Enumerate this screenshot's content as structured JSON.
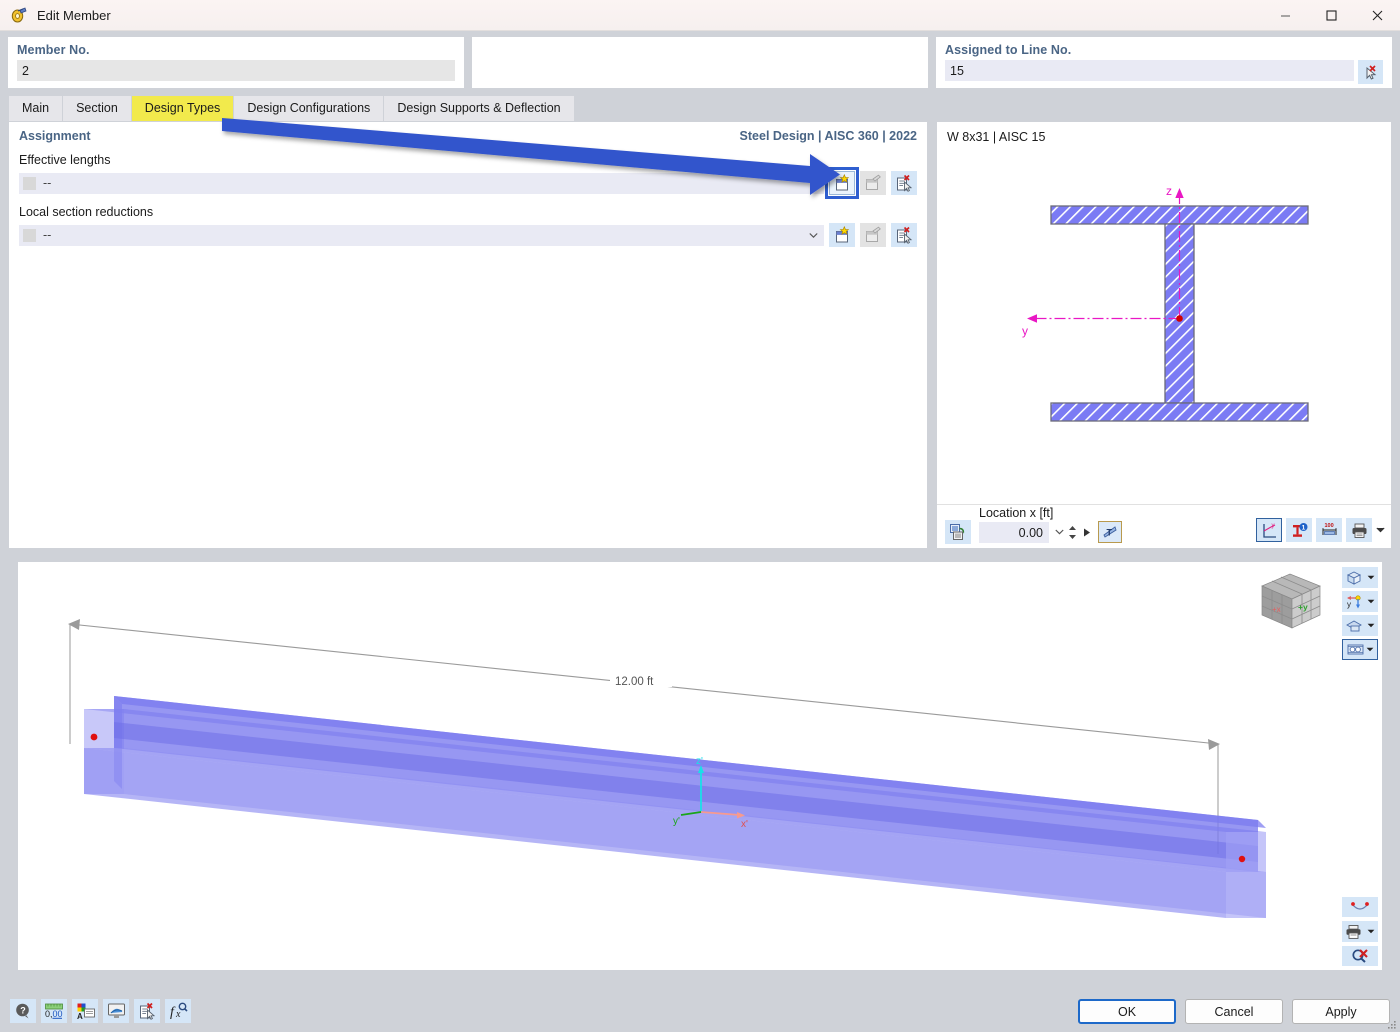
{
  "window": {
    "title": "Edit Member",
    "icon": "member-icon",
    "minimize_label": "—",
    "maximize_label": "☐",
    "close_label": "✕"
  },
  "header": {
    "member": {
      "label": "Member No.",
      "value": "2"
    },
    "middle": {
      "value": ""
    },
    "line": {
      "label": "Assigned to Line No.",
      "value": "15",
      "pick_icon": "select-cursor-icon"
    }
  },
  "tabs": [
    {
      "label": "Main",
      "active": false
    },
    {
      "label": "Section",
      "active": false
    },
    {
      "label": "Design Types",
      "active": true
    },
    {
      "label": "Design Configurations",
      "active": false
    },
    {
      "label": "Design Supports & Deflection",
      "active": false
    }
  ],
  "assignment": {
    "title": "Assignment",
    "standard": "Steel Design | AISC 360 | 2022",
    "rows": [
      {
        "label": "Effective lengths",
        "value": "--",
        "new_icon": "new-document-icon",
        "edit_icon": "edit-document-icon",
        "pick_icon": "select-document-icon"
      },
      {
        "label": "Local section reductions",
        "value": "--",
        "new_icon": "new-document-icon",
        "edit_icon": "edit-document-icon",
        "pick_icon": "select-document-icon"
      }
    ]
  },
  "section": {
    "title": "W 8x31 | AISC 15",
    "axis_z": "z",
    "axis_y": "y",
    "location_label": "Location x [ft]",
    "location_value": "0.00",
    "toolbar_left_icon": "export-image-icon",
    "toolbar_icons": [
      "coordinate-system-icon",
      "section-properties-icon",
      "dimensions-icon",
      "print-icon"
    ],
    "rotate_icon": "rotate-section-icon"
  },
  "viewport": {
    "dimension_label": "12.00 ft",
    "axis_x": "x'",
    "axis_y": "y'",
    "axis_z": "z'",
    "cube_face_y": "+y",
    "cube_face_x": "+x",
    "side_buttons": [
      {
        "icon": "render-mode-icon",
        "selected": false
      },
      {
        "icon": "view-direction-icon",
        "selected": false
      },
      {
        "icon": "display-style-icon",
        "selected": false
      },
      {
        "icon": "visibility-icon",
        "selected": true
      }
    ],
    "bottom_buttons": [
      {
        "icon": "smile-icon"
      },
      {
        "icon": "print-icon"
      },
      {
        "icon": "zoom-reset-icon"
      }
    ]
  },
  "footer": {
    "icons": [
      "help-icon",
      "number-format-icon",
      "display-properties-icon",
      "render-settings-icon",
      "delete-selection-icon",
      "function-icon"
    ],
    "buttons": [
      {
        "label": "OK",
        "primary": true
      },
      {
        "label": "Cancel",
        "primary": false
      },
      {
        "label": "Apply",
        "primary": false
      }
    ]
  },
  "annotation": {
    "arrow_color": "#3355cc",
    "highlight_color": "#f2ea4c"
  }
}
